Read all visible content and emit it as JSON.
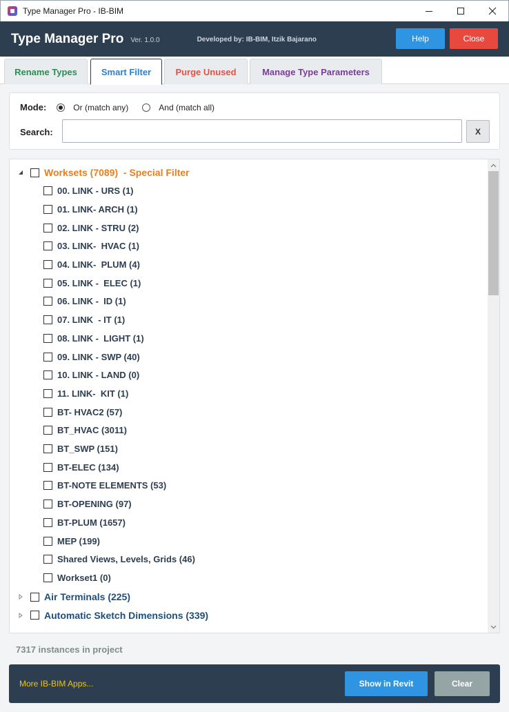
{
  "window": {
    "title": "Type Manager Pro - IB-BIM"
  },
  "header": {
    "brand": "Type Manager Pro",
    "version": "Ver. 1.0.0",
    "developer": "Developed by: IB-BIM, Itzik Bajarano",
    "help_label": "Help",
    "close_label": "Close"
  },
  "tabs": [
    {
      "label": "Rename Types",
      "color": "#2e8b57"
    },
    {
      "label": "Smart Filter",
      "color": "#2f80c9",
      "active": true
    },
    {
      "label": "Purge Unused",
      "color": "#e0524a"
    },
    {
      "label": "Manage Type Parameters",
      "color": "#7a3d98"
    }
  ],
  "filter": {
    "mode_label": "Mode:",
    "mode_options": [
      {
        "label": "Or (match any)",
        "selected": true
      },
      {
        "label": "And (match all)",
        "selected": false
      }
    ],
    "search_label": "Search:",
    "search_value": "",
    "clear_label": "X"
  },
  "tree": {
    "worksets": {
      "label": "Worksets (7089)",
      "suffix": "  - Special Filter",
      "expanded": true,
      "children": [
        "00. LINK - URS (1)",
        "01. LINK- ARCH (1)",
        "02. LINK - STRU (2)",
        "03. LINK-  HVAC (1)",
        "04. LINK-  PLUM (4)",
        "05. LINK -  ELEC (1)",
        "06. LINK -  ID (1)",
        "07. LINK  - IT (1)",
        "08. LINK -  LIGHT (1)",
        "09. LINK - SWP (40)",
        "10. LINK - LAND (0)",
        "11. LINK-  KIT (1)",
        "BT- HVAC2 (57)",
        "BT_HVAC (3011)",
        "BT_SWP (151)",
        "BT-ELEC (134)",
        "BT-NOTE ELEMENTS (53)",
        "BT-OPENING (97)",
        "BT-PLUM (1657)",
        "MEP (199)",
        "Shared Views, Levels, Grids (46)",
        "Workset1 (0)"
      ]
    },
    "categories": [
      {
        "label": "Air Terminals (225)",
        "expanded": false
      },
      {
        "label": "Automatic Sketch Dimensions (339)",
        "expanded": false
      }
    ]
  },
  "status": {
    "instances": "7317 instances in project"
  },
  "footer": {
    "more_label": "More IB-BIM Apps...",
    "show_label": "Show in Revit",
    "clear_label": "Clear"
  }
}
